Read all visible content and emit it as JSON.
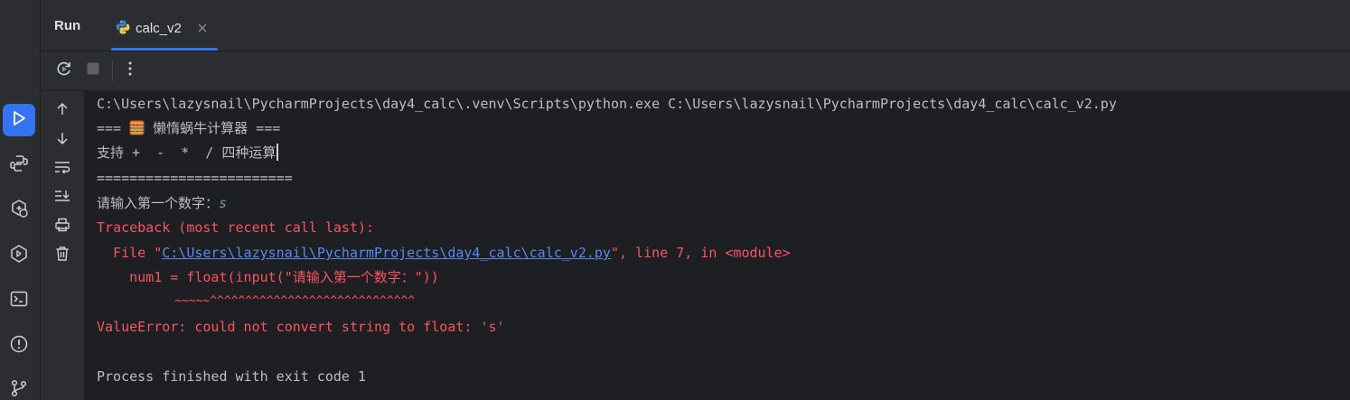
{
  "tool_window": {
    "title": "Run",
    "tab": {
      "label": "calc_v2",
      "icon": "python-file-icon",
      "close_icon": "close-icon"
    }
  },
  "toolbar": {
    "rerun_icon": "rerun-icon",
    "stop_icon": "stop-icon",
    "more_icon": "more-vertical-icon"
  },
  "activity_bar": {
    "items": [
      "run-icon",
      "python-packages-icon",
      "services-icon",
      "python-console-icon",
      "terminal-icon",
      "problems-icon",
      "git-icon"
    ],
    "active": "run-icon"
  },
  "console_side": [
    "arrow-up-icon",
    "arrow-down-icon",
    "soft-wrap-icon",
    "scroll-to-end-icon",
    "print-icon",
    "trash-icon"
  ],
  "console": {
    "cmd": "C:\\Users\\lazysnail\\PycharmProjects\\day4_calc\\.venv\\Scripts\\python.exe C:\\Users\\lazysnail\\PycharmProjects\\day4_calc\\calc_v2.py",
    "banner_left": "=== ",
    "banner_right": " 懒惰蜗牛计算器 ===",
    "ops": "支持 +  -  *  / 四种运算",
    "divider": "========================",
    "prompt": "请输入第一个数字：",
    "user_input": "s",
    "traceback": "Traceback (most recent call last):",
    "file_prefix": "  File \"",
    "file_path": "C:\\Users\\lazysnail\\PycharmProjects\\day4_calc\\calc_v2.py",
    "file_suffix": "\", line 7, in <module>",
    "code_line": "    num1 = float(input(\"请输入第一个数字：\"))",
    "marker_line": "           ~~~~~^^^^^^^^^^^^^^^^^^^^^^^^^^^^^",
    "error": "ValueError: could not convert string to float: 's'",
    "exit": "Process finished with exit code 1"
  },
  "colors": {
    "accent": "#3574f0",
    "error": "#f75464",
    "input": "#6aab73",
    "link": "#548af7",
    "text": "#bcbec4",
    "panel": "#2b2d30",
    "editor_bg": "#1e1f22"
  }
}
